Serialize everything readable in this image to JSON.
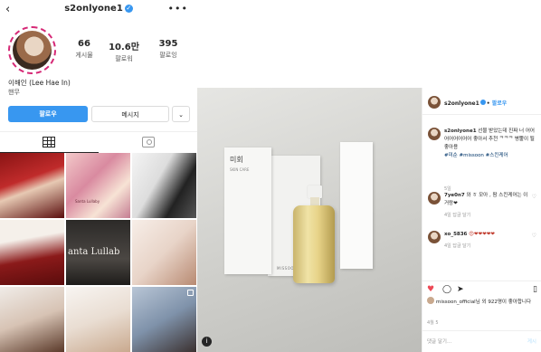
{
  "profile": {
    "username": "s2onlyone1",
    "back_icon": "chevron-left-icon",
    "more_icon": "more-dots-icon",
    "stats": [
      {
        "value": "66",
        "label": "게시물"
      },
      {
        "value": "10.6만",
        "label": "팔로워"
      },
      {
        "value": "395",
        "label": "팔로잉"
      }
    ],
    "full_name": "이해인 (Lee Hae In)",
    "bio": "핸무",
    "follow_button": "팔로우",
    "message_button": "메시지",
    "more_button": "⌄",
    "tabs": [
      "grid-icon",
      "tagged-icon"
    ],
    "grid_cells": [
      {
        "caption": ""
      },
      {
        "caption": "Santa Lullaby"
      },
      {
        "caption": ""
      },
      {
        "caption": ""
      },
      {
        "caption": "anta Lullab"
      },
      {
        "caption": ""
      },
      {
        "caption": ""
      },
      {
        "caption": ""
      },
      {
        "caption": ""
      }
    ]
  },
  "post": {
    "username": "s2onlyone1",
    "follow_label": "팔로우",
    "caption_user": "s2onlyone1",
    "caption_text": "선물 받았는데 진짜 너 어어어어어어어어 좋아서 추천 ᄏᄏᄏ 병뿔이 될 좋아용",
    "hashtags": "#미순 #missoon #스킨케어",
    "caption_time": "5일",
    "comments": [
      {
        "user": "7ye0n7",
        "text": "와 ㅎ 모아 , 팜 스킨케어는 이거랑❤",
        "meta": "4일   답글 달기"
      },
      {
        "user": "xo_5836",
        "text": "😍❤❤❤❤❤",
        "meta": "4일   답글 달기"
      }
    ],
    "likes_text": "missoon_official님 외 922명이 좋아합니다",
    "post_time": "4월 5",
    "add_comment_placeholder": "댓글 달기...",
    "post_button": "게시"
  },
  "photo": {
    "box_left_label": "미회",
    "box_left_sub": "SKIN CARE",
    "brand": "MISSOON"
  },
  "colors": {
    "accent": "#3897f0",
    "like": "#ed4956",
    "avatar_ring": "#d62976"
  }
}
